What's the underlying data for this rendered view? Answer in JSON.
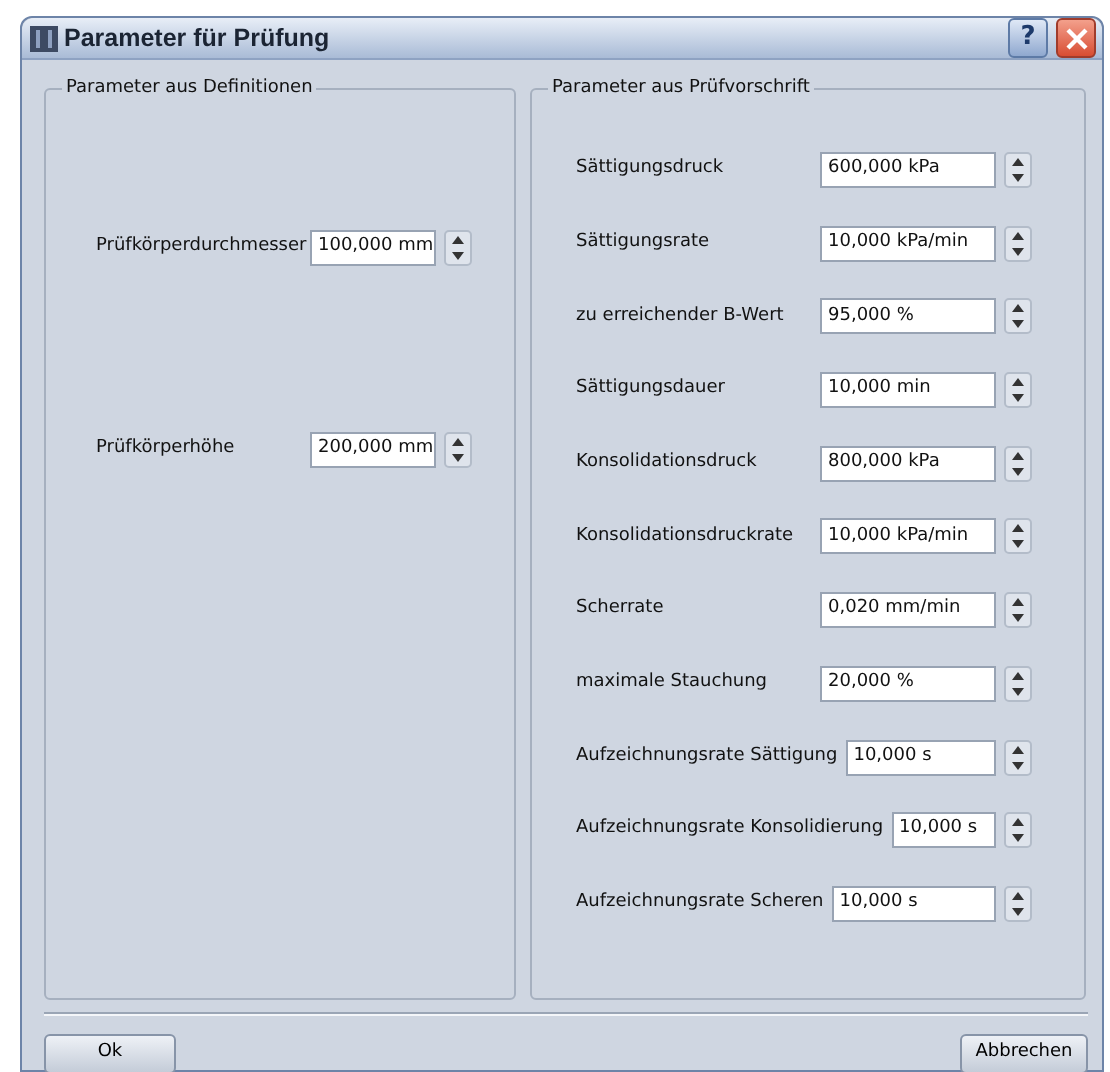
{
  "window": {
    "title": "Parameter für Prüfung",
    "help_button": "?"
  },
  "groups": [
    {
      "title": "Parameter aus Definitionen",
      "fields": [
        {
          "label": "Prüfkörperdurchmesser",
          "value": "100,000 mm"
        },
        {
          "label": "Prüfkörperhöhe",
          "value": "200,000 mm"
        }
      ]
    },
    {
      "title": "Parameter aus Prüfvorschrift",
      "fields": [
        {
          "label": "Sättigungsdruck",
          "value": "600,000 kPa"
        },
        {
          "label": "Sättigungsrate",
          "value": "10,000 kPa/min"
        },
        {
          "label": "zu erreichender B-Wert",
          "value": "95,000 %"
        },
        {
          "label": "Sättigungsdauer",
          "value": "10,000 min"
        },
        {
          "label": "Konsolidationsdruck",
          "value": "800,000 kPa"
        },
        {
          "label": "Konsolidationsdruckrate",
          "value": "10,000 kPa/min"
        },
        {
          "label": "Scherrate",
          "value": "0,020 mm/min"
        },
        {
          "label": "maximale Stauchung",
          "value": "20,000 %"
        },
        {
          "label": "Aufzeichnungsrate Sättigung",
          "value": "10,000 s"
        },
        {
          "label": "Aufzeichnungsrate Konsolidierung",
          "value": "10,000 s"
        },
        {
          "label": "Aufzeichnungsrate Scheren",
          "value": "10,000 s"
        }
      ]
    }
  ],
  "buttons": [
    "Ok",
    "Abbrechen"
  ]
}
